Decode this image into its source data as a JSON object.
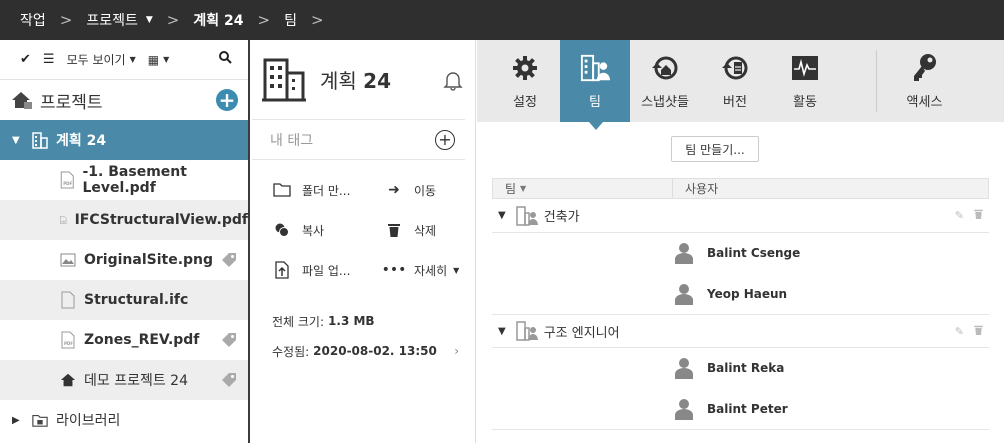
{
  "breadcrumb": {
    "items": [
      "작업",
      "프로젝트",
      "계획 24",
      "팀"
    ]
  },
  "left": {
    "toolbar": {
      "filter_label": "모두 보이기"
    },
    "projects_title": "프로젝트",
    "tree": [
      {
        "label": "계획 24",
        "selected": true
      },
      {
        "label": "-1. Basement Level.pdf"
      },
      {
        "label": "IFCStructuralView.pdf"
      },
      {
        "label": "OriginalSite.png"
      },
      {
        "label": "Structural.ifc"
      },
      {
        "label": "Zones_REV.pdf"
      },
      {
        "label": "데모 프로젝트 24"
      },
      {
        "label": "라이브러리"
      }
    ]
  },
  "middle": {
    "title_prefix": "계획",
    "title_num": "24",
    "tag_placeholder": "내 태그",
    "actions": [
      "폴더 만...",
      "이동",
      "복사",
      "삭제",
      "파일 업...",
      "자세히"
    ],
    "size_label": "전체 크기:",
    "size_value": "1.3 MB",
    "modified_label": "수정됨:",
    "modified_value": "2020-08-02. 13:50"
  },
  "right": {
    "tabs": [
      "설정",
      "팀",
      "스냅샷들",
      "버전",
      "활동",
      "액세스"
    ],
    "create_team_label": "팀 만들기...",
    "col_team": "팀",
    "col_users": "사용자",
    "teams": [
      {
        "name": "건축가",
        "members": [
          "Balint Csenge",
          "Yeop Haeun"
        ]
      },
      {
        "name": "구조 엔지니어",
        "members": [
          "Balint Reka",
          "Balint Peter"
        ]
      }
    ]
  },
  "colors": {
    "accent": "#4a8aa8",
    "topbar": "#2f2f2f",
    "plus": "#3c8bb0"
  }
}
